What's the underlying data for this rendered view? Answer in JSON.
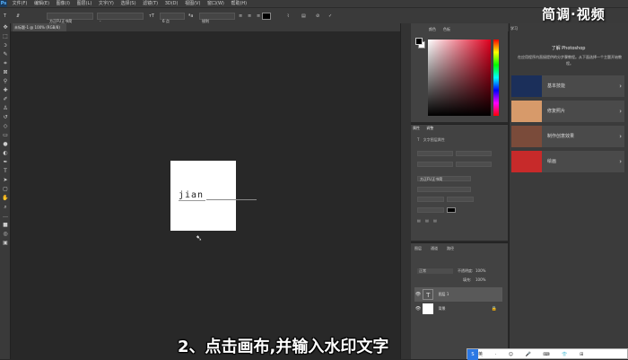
{
  "menu": {
    "items": [
      "文件(F)",
      "编辑(E)",
      "图像(I)",
      "图层(L)",
      "文字(Y)",
      "选择(S)",
      "滤镜(T)",
      "3D(D)",
      "视图(V)",
      "窗口(W)",
      "帮助(H)"
    ]
  },
  "options": {
    "font_family": "方正FU正书简",
    "font_style": "-",
    "font_size": "6 点",
    "aa": "锐利"
  },
  "document": {
    "tab_title": "未标题-1 @ 100% (RGB/8)",
    "canvas_text": "jian"
  },
  "panels": {
    "color_tabs": [
      "颜色",
      "色板"
    ],
    "props_tabs": [
      "属性",
      "调整"
    ],
    "props_header": "文字图层属性",
    "props_font": "方正FU正书简",
    "layers_tabs": [
      "图层",
      "通道",
      "路径"
    ],
    "layers_mode": "正常",
    "layers_opacity_label": "不透明度:",
    "layers_opacity": "100%",
    "layers_fill_label": "填充:",
    "layers_fill": "100%",
    "layers": [
      {
        "name": "图层 1",
        "type": "text",
        "selected": true
      },
      {
        "name": "背景",
        "type": "background",
        "selected": false
      }
    ]
  },
  "learn": {
    "tab": "学习",
    "title": "了解 Photoshop",
    "desc": "在应用程序内直接提供的分步骤教程。从下面选择一个主题开始教程。",
    "items": [
      {
        "label": "基本技能",
        "color": "#1b2f5a"
      },
      {
        "label": "修复照片",
        "color": "#d79a6a"
      },
      {
        "label": "制作创意效果",
        "color": "#7a4b3a"
      },
      {
        "label": "绘画",
        "color": "#c72a2a"
      }
    ]
  },
  "watermark": "简调·视频",
  "subtitle": "2、点击画布,并输入水印文字",
  "ime": {
    "logo": "S",
    "items": [
      "英",
      "·",
      "☺",
      "🎤",
      "⌨",
      "👕",
      "⊞"
    ]
  }
}
